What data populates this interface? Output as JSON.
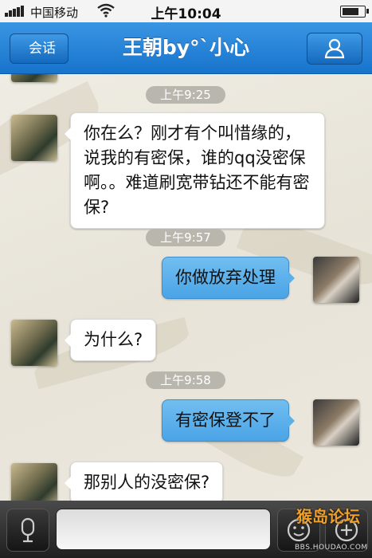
{
  "status_bar": {
    "carrier": "中国移动",
    "time": "上午10:04",
    "battery_level": 0.85
  },
  "nav": {
    "back_label": "会话",
    "title": "王朝by°ˋ小心",
    "profile_icon": "person-icon"
  },
  "messages": [
    {
      "side": "in",
      "text": "你在么？刚才有个叫惜缘的，说我的有密保，谁的qq没密保啊。。难道刷宽带钻还不能有密保?"
    },
    {
      "side": "out",
      "text": "你做放弃处理"
    },
    {
      "side": "in",
      "text": "为什么?"
    },
    {
      "side": "out",
      "text": "有密保登不了"
    },
    {
      "side": "in",
      "text": "那别人的没密保?"
    }
  ],
  "timestamps": [
    "上午9:25",
    "上午9:57",
    "上午9:58"
  ],
  "input_bar": {
    "voice_icon": "microphone-icon",
    "emoji_icon": "emoji-icon",
    "more_icon": "plus-icon",
    "text_value": ""
  },
  "watermark": {
    "logo": "猴岛论坛",
    "url": "BBS.HOUDAO.COM"
  },
  "colors": {
    "nav_blue": "#1f7fd6",
    "outgoing_bubble": "#5bb0ea",
    "incoming_bubble": "#ffffff",
    "timestamp_pill": "#b9b6ad"
  }
}
